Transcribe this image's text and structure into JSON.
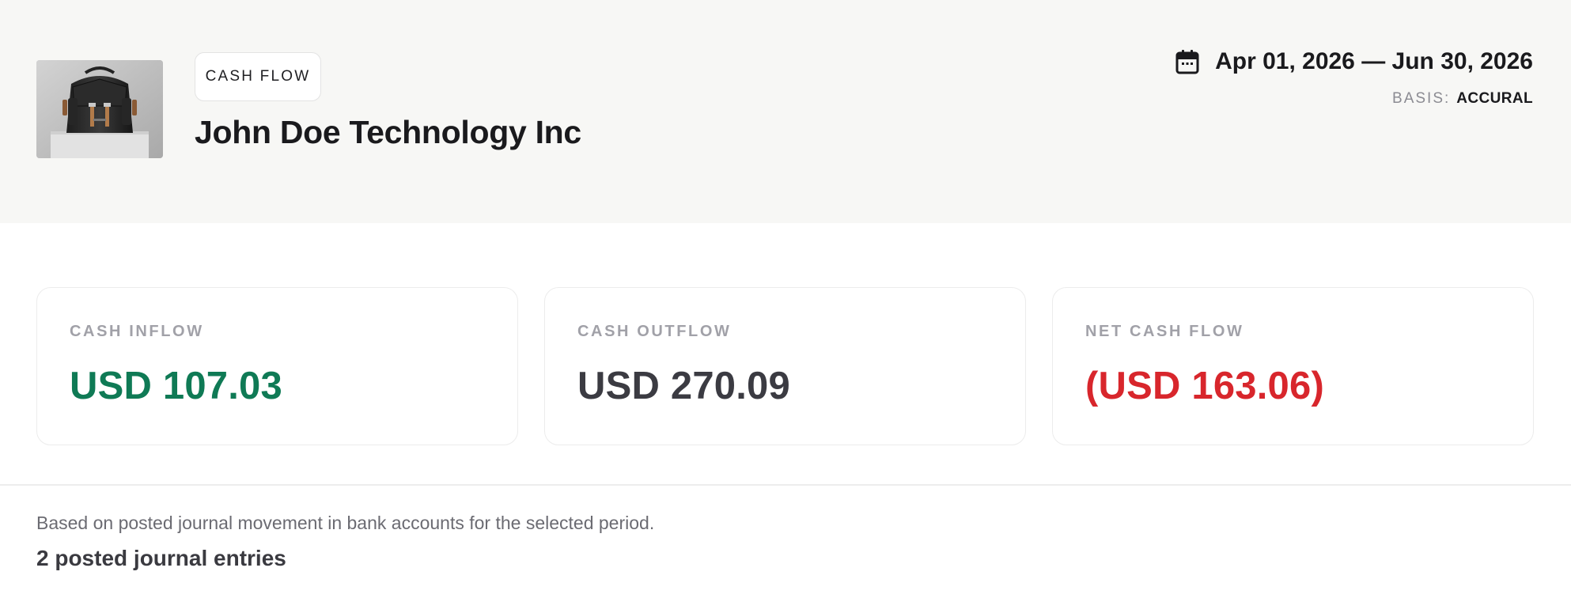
{
  "header": {
    "badge": "CASH FLOW",
    "company_name": "John Doe Technology Inc",
    "logo_icon": "backpack-product-photo",
    "date_icon": "calendar-icon",
    "date_range": "Apr 01, 2026 — Jun 30, 2026",
    "basis_label": "BASIS:",
    "basis_value": "ACCURAL"
  },
  "summary": {
    "cards": [
      {
        "label": "CASH INFLOW",
        "value": "USD 107.03",
        "color": "#0f7a55"
      },
      {
        "label": "CASH OUTFLOW",
        "value": "USD 270.09",
        "color": "#3b3b42"
      },
      {
        "label": "NET CASH FLOW",
        "value": "(USD 163.06)",
        "color": "#d8262c"
      }
    ]
  },
  "footer": {
    "note": "Based on posted journal movement in bank accounts for the selected period.",
    "entries": "2 posted journal entries"
  },
  "colors": {
    "header_bg": "#f7f7f5",
    "positive": "#0f7a55",
    "negative": "#d8262c",
    "muted": "#a1a1a8"
  }
}
